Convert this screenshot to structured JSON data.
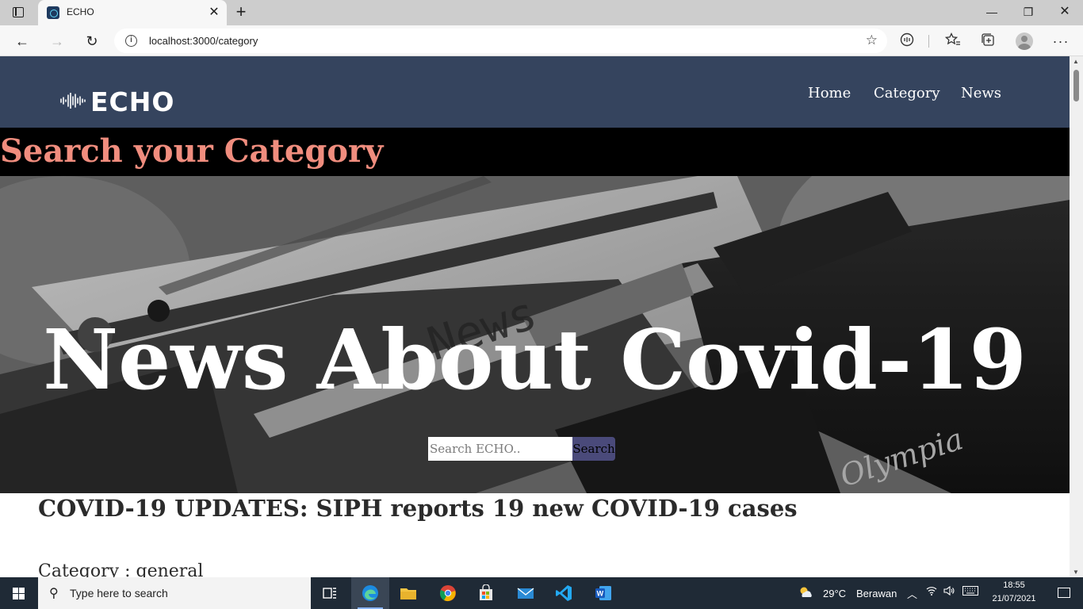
{
  "browser": {
    "tab_title": "ECHO",
    "url": "localhost:3000/category",
    "tab_close_glyph": "✕",
    "new_tab_glyph": "+",
    "back_glyph": "←",
    "forward_glyph": "→",
    "reload_glyph": "↻",
    "more_glyph": "···",
    "min_glyph": "—",
    "max_glyph": "❐",
    "close_glyph": "✕"
  },
  "site": {
    "logo_text": "ECHO",
    "nav": {
      "home": "Home",
      "category": "Category",
      "news": "News"
    },
    "search_title": "Search your Category",
    "hero_heading": "News About Covid-19",
    "search_placeholder": "Search ECHO..",
    "search_button": "Search",
    "article": {
      "title": "COVID-19 UPDATES: SIPH reports 19 new COVID-19 cases",
      "category": "Category : general"
    },
    "colors": {
      "header_bg": "#35445e",
      "title_accent": "#f08d7e",
      "search_button_bg": "#4a4a7a"
    }
  },
  "taskbar": {
    "search_text": "Type here to search",
    "weather_temp": "29°C",
    "weather_cond": "Berawan",
    "time": "18:55",
    "date": "21/07/2021",
    "apps": [
      "task-view",
      "edge",
      "file-explorer",
      "chrome",
      "store",
      "mail",
      "vscode",
      "word"
    ]
  }
}
